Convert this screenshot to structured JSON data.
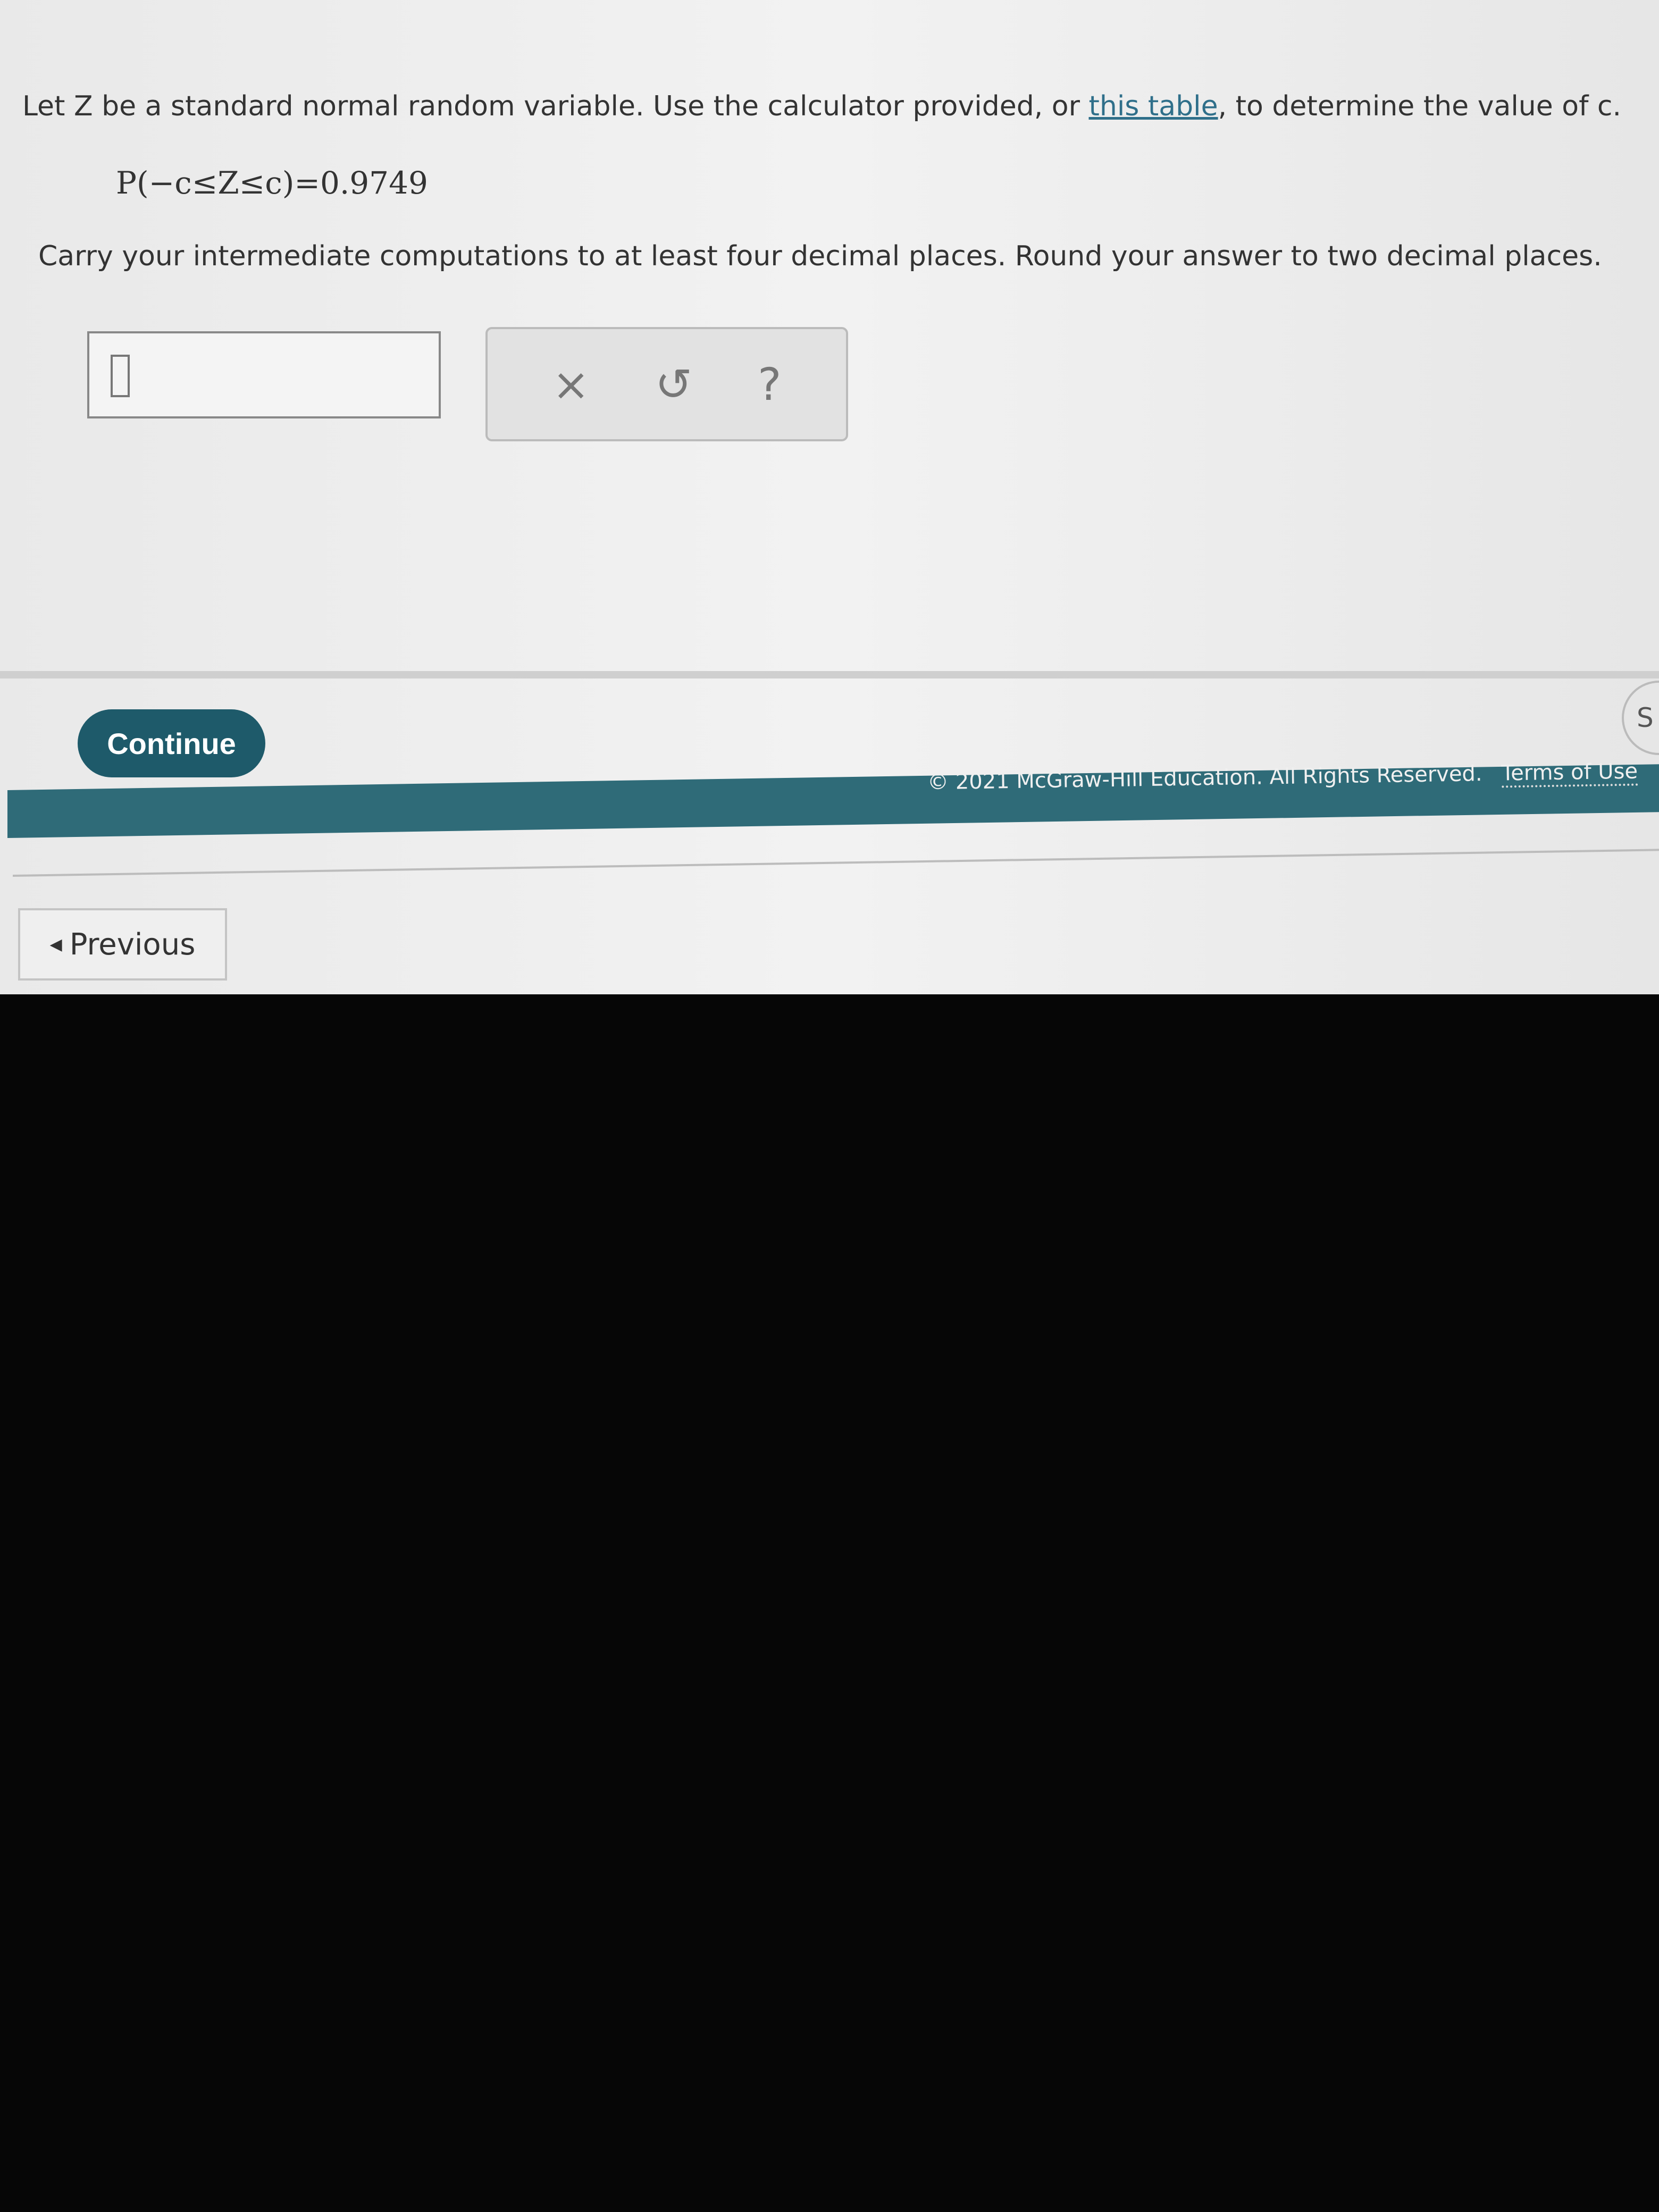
{
  "question": {
    "prefix": "Let Z be a standard normal random variable. Use the calculator provided, or ",
    "link": "this table",
    "suffix": ", to determine the value of c.",
    "formula": "P(−c≤Z≤c)=0.9749",
    "instruction": "Carry your intermediate computations to at least four decimal places. Round your answer to two decimal places."
  },
  "answer": {
    "value": ""
  },
  "tools": {
    "clear": "×",
    "undo": "↺",
    "help": "?"
  },
  "buttons": {
    "continue": "Continue",
    "previous": "Previous",
    "side": "S"
  },
  "footer": {
    "copyright": "© 2021 McGraw-Hill Education. All Rights Reserved.",
    "terms": "Terms of Use"
  },
  "colors": {
    "accent": "#1e5a6a",
    "link": "#2f6f8a",
    "footer_bar": "#2f6b78"
  }
}
